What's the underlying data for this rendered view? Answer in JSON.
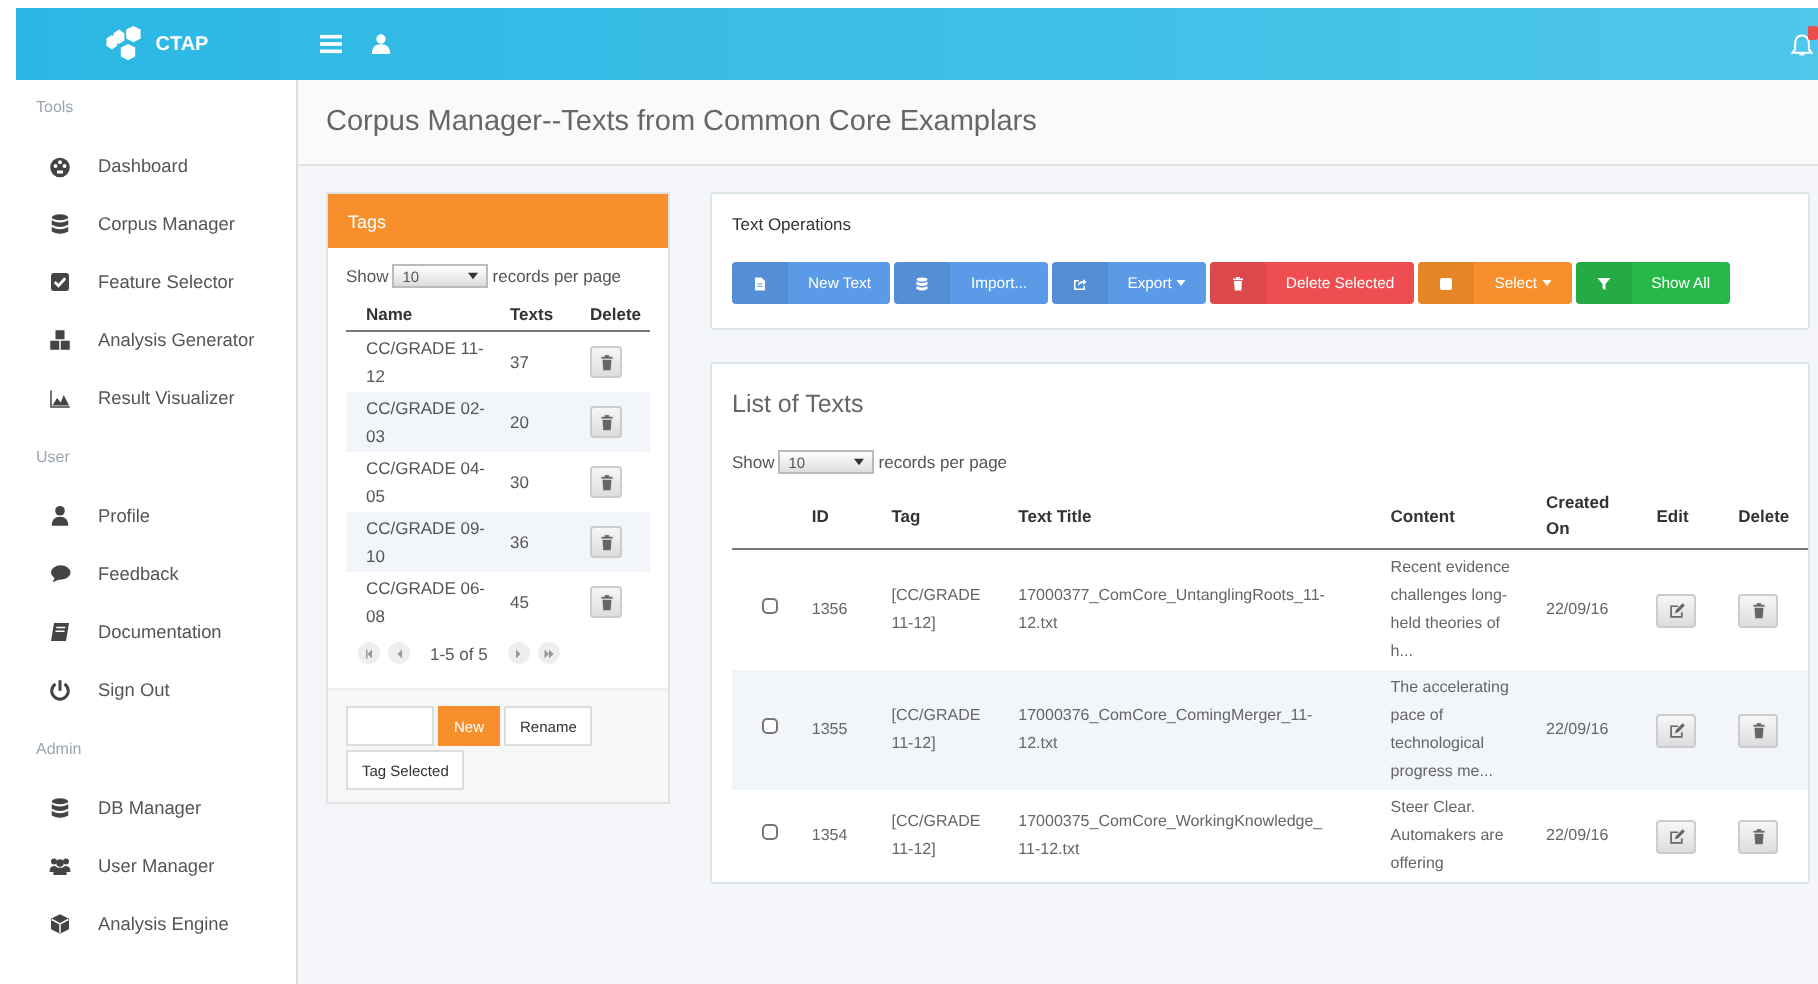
{
  "header": {
    "logo": "CTAP",
    "notification_badge": true
  },
  "sidebar": {
    "sections": [
      {
        "title": "Tools",
        "items": [
          {
            "label": "Dashboard"
          },
          {
            "label": "Corpus Manager"
          },
          {
            "label": "Feature Selector"
          },
          {
            "label": "Analysis Generator"
          },
          {
            "label": "Result Visualizer"
          }
        ]
      },
      {
        "title": "User",
        "items": [
          {
            "label": "Profile"
          },
          {
            "label": "Feedback"
          },
          {
            "label": "Documentation"
          },
          {
            "label": "Sign Out"
          }
        ]
      },
      {
        "title": "Admin",
        "items": [
          {
            "label": "DB Manager"
          },
          {
            "label": "User Manager"
          },
          {
            "label": "Analysis Engine"
          }
        ]
      }
    ]
  },
  "page_title": "Corpus Manager--Texts from Common Core Examplars",
  "tags_panel": {
    "title": "Tags",
    "show_label": "Show",
    "page_size": "10",
    "per_page_label": "records per page",
    "columns": [
      "Name",
      "Texts",
      "Delete"
    ],
    "rows": [
      {
        "name": "CC/GRADE 11-12",
        "texts": "37"
      },
      {
        "name": "CC/GRADE 02-03",
        "texts": "20"
      },
      {
        "name": "CC/GRADE 04-05",
        "texts": "30"
      },
      {
        "name": "CC/GRADE 09-10",
        "texts": "36"
      },
      {
        "name": "CC/GRADE 06-08",
        "texts": "45"
      }
    ],
    "pagination": "1-5 of 5",
    "buttons": [
      {
        "label": "New",
        "primary": true
      },
      {
        "label": "Rename",
        "primary": false
      },
      {
        "label": "Tag Selected",
        "primary": false
      }
    ]
  },
  "text_operations": {
    "title": "Text Operations",
    "buttons": [
      {
        "label": "New Text",
        "color": "#5b9ae6",
        "dropdown": false
      },
      {
        "label": "Import...",
        "color": "#5b9ae6",
        "dropdown": false
      },
      {
        "label": "Export",
        "color": "#5b9ae6",
        "dropdown": true
      },
      {
        "label": "Delete Selected",
        "color": "#ee4e52",
        "dropdown": false
      },
      {
        "label": "Select",
        "color": "#f7902c",
        "dropdown": true
      },
      {
        "label": "Show All",
        "color": "#27b84a",
        "dropdown": false
      }
    ]
  },
  "text_list": {
    "title": "List of Texts",
    "show_label": "Show",
    "page_size": "10",
    "per_page_label": "records per page",
    "columns": [
      "ID",
      "Tag",
      "Text Title",
      "Content",
      "Created On",
      "Edit",
      "Delete"
    ],
    "rows": [
      {
        "checked": false,
        "id": "1356",
        "tag": "[CC/GRADE 11-12]",
        "title": "17000377_ComCore_UntanglingRoots_11-12.txt",
        "content": "Recent evidence challenges long-held theories of h...",
        "created": "22/09/16"
      },
      {
        "checked": false,
        "id": "1355",
        "tag": "[CC/GRADE 11-12]",
        "title": "17000376_ComCore_ComingMerger_11-12.txt",
        "content": "The accelerating pace of technological progress me...",
        "created": "22/09/16"
      },
      {
        "checked": false,
        "id": "1354",
        "tag": "[CC/GRADE 11-12]",
        "title": "17000375_ComCore_WorkingKnowledge_11-12.txt",
        "content": "Steer Clear. Automakers are offering",
        "created": "22/09/16"
      }
    ]
  }
}
